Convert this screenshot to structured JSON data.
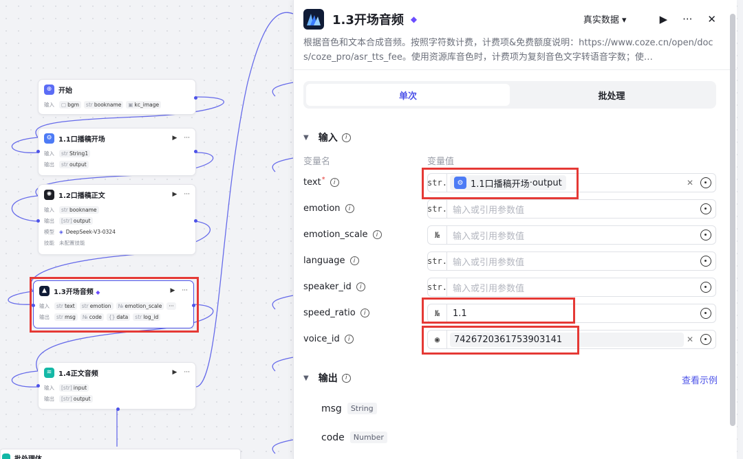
{
  "nodes": {
    "start": {
      "title": "开始",
      "in_label": "输入",
      "inputs": [
        {
          "type": "▢",
          "name": "bgm"
        },
        {
          "type": "str",
          "name": "bookname"
        },
        {
          "type": "▣",
          "name": "kc_image"
        }
      ]
    },
    "n11": {
      "title": "1.1口播稿开场",
      "in_label": "输入",
      "out_label": "输出",
      "input": {
        "type": "str",
        "name": "String1"
      },
      "output": {
        "type": "str",
        "name": "output"
      }
    },
    "n12": {
      "title": "1.2口播稿正文",
      "in_label": "输入",
      "out_label": "输出",
      "model_label": "模型",
      "skill_label": "技能",
      "input": {
        "type": "str",
        "name": "bookname"
      },
      "output": {
        "type": "[str]",
        "name": "output"
      },
      "model": "DeepSeek-V3-0324",
      "skill": "未配置技能"
    },
    "n13": {
      "title": "1.3开场音频",
      "in_label": "输入",
      "out_label": "输出",
      "inputs": [
        {
          "type": "str",
          "name": "text"
        },
        {
          "type": "str",
          "name": "emotion"
        },
        {
          "type": "№",
          "name": "emotion_scale"
        }
      ],
      "more": "···",
      "outputs": [
        {
          "type": "str",
          "name": "msg"
        },
        {
          "type": "№",
          "name": "code"
        },
        {
          "type": "{}",
          "name": "data"
        },
        {
          "type": "str",
          "name": "log_id"
        }
      ]
    },
    "n14": {
      "title": "1.4正文音频",
      "in_label": "输入",
      "out_label": "输出",
      "input": {
        "type": "[str]",
        "name": "input"
      },
      "output": {
        "type": "[str]",
        "name": "output"
      }
    },
    "n15": {
      "title": "批处理体"
    }
  },
  "panel": {
    "title": "1.3开场音频",
    "data_mode": "真实数据 ▾",
    "run_icon": "play-icon",
    "more_icon": "more-icon",
    "close_icon": "close-icon",
    "description": "根据音色和文本合成音频。按照字符数计费，计费项&免费额度说明：https://www.coze.cn/open/docs/coze_pro/asr_tts_fee。使用资源库音色时，计费项为复刻音色文字转语音字数；使…",
    "tabs": [
      "单次",
      "批处理"
    ],
    "active_tab": "单次",
    "input_section": "输入",
    "col_name": "变量名",
    "col_value": "变量值",
    "params": [
      {
        "name": "text",
        "required": "*",
        "type": "str.",
        "ref_node": "1.1口播稿开场",
        "ref_sep": " · ",
        "ref_field": "output"
      },
      {
        "name": "emotion",
        "type": "str.",
        "placeholder": "输入或引用参数值"
      },
      {
        "name": "emotion_scale",
        "type": "№",
        "placeholder": "输入或引用参数值"
      },
      {
        "name": "language",
        "type": "str.",
        "placeholder": "输入或引用参数值"
      },
      {
        "name": "speaker_id",
        "type": "str.",
        "placeholder": "输入或引用参数值"
      },
      {
        "name": "speed_ratio",
        "type": "№",
        "value": "1.1"
      },
      {
        "name": "voice_id",
        "type": "◉",
        "value": "7426720361753903141"
      }
    ],
    "output_section": "输出",
    "view_example": "查看示例",
    "outputs": [
      {
        "name": "msg",
        "type": "String"
      },
      {
        "name": "code",
        "type": "Number"
      }
    ]
  }
}
